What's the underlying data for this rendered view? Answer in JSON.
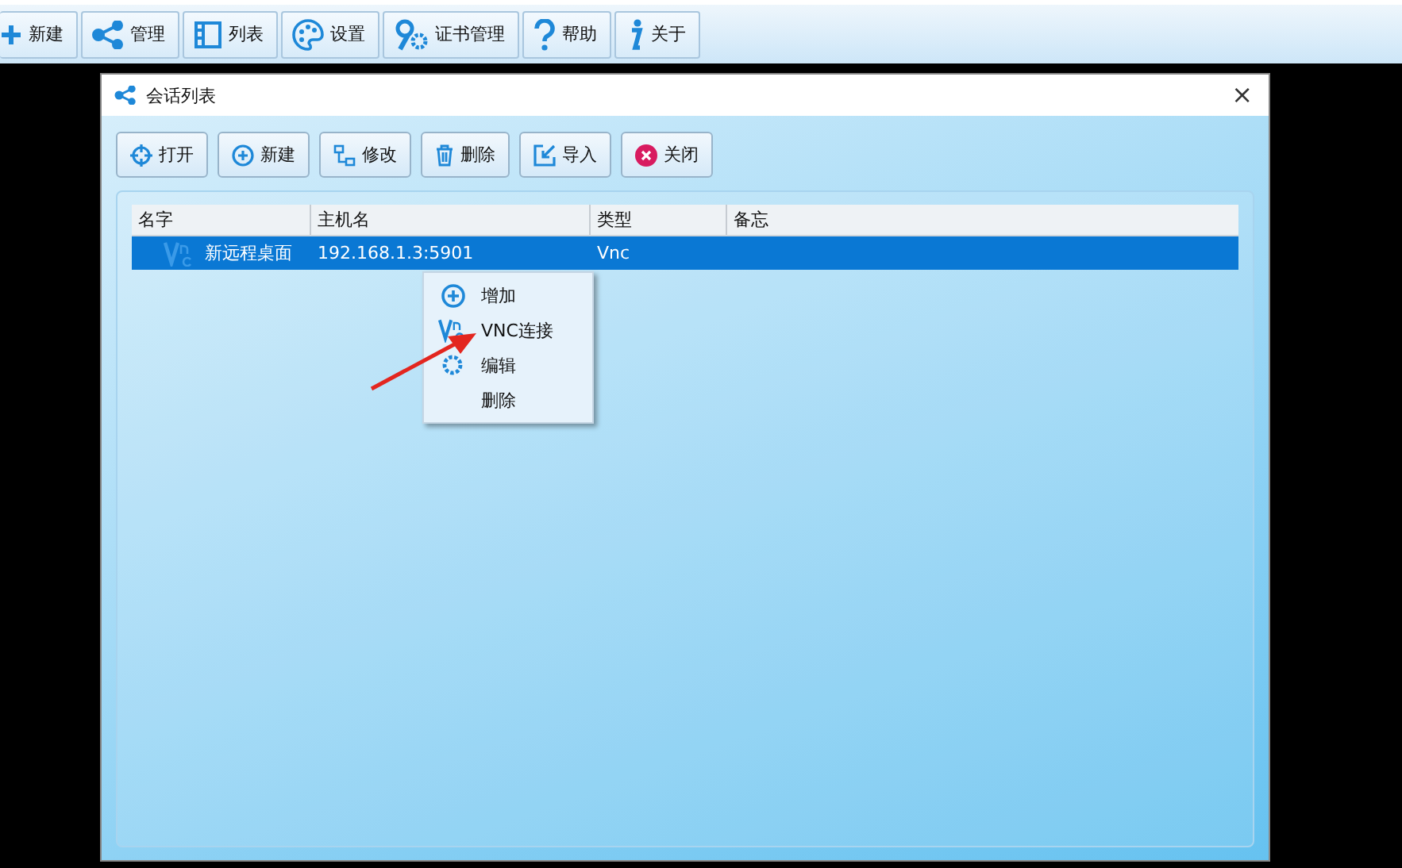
{
  "toolbar": [
    {
      "label": "新建"
    },
    {
      "label": "管理"
    },
    {
      "label": "列表"
    },
    {
      "label": "设置"
    },
    {
      "label": "证书管理"
    },
    {
      "label": "帮助"
    },
    {
      "label": "关于"
    }
  ],
  "dialog": {
    "title": "会话列表",
    "close": "×",
    "buttons": [
      {
        "label": "打开"
      },
      {
        "label": "新建"
      },
      {
        "label": "修改"
      },
      {
        "label": "删除"
      },
      {
        "label": "导入"
      },
      {
        "label": "关闭"
      }
    ],
    "table": {
      "columns": [
        "名字",
        "主机名",
        "类型",
        "备忘"
      ],
      "rows": [
        {
          "selected": true,
          "cells": [
            "新远程桌面",
            "192.168.1.3:5901",
            "Vnc",
            ""
          ]
        }
      ]
    },
    "context_menu": [
      {
        "label": "增加"
      },
      {
        "label": "VNC连接"
      },
      {
        "label": "编辑"
      },
      {
        "label": "删除"
      }
    ]
  }
}
